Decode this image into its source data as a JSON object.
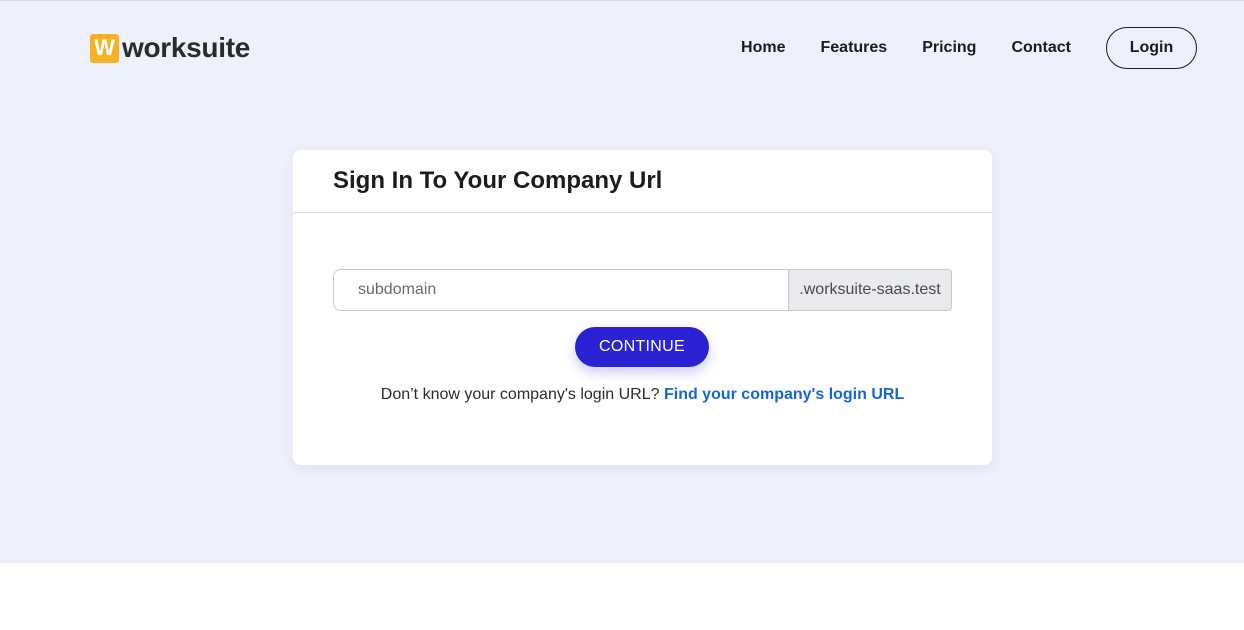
{
  "header": {
    "logo_mark": "W",
    "logo_text": "worksuite",
    "nav": [
      "Home",
      "Features",
      "Pricing",
      "Contact"
    ],
    "login_label": "Login"
  },
  "card": {
    "title": "Sign In To Your Company Url",
    "subdomain_placeholder": "subdomain",
    "subdomain_value": "",
    "domain_suffix": ".worksuite-saas.test",
    "continue_label": "CONTINUE",
    "help_text": "Don’t know your company's login URL?",
    "help_link": "Find your company's login URL"
  },
  "colors": {
    "hero_background": "#eef0fc",
    "logo_mark": "#f5b324",
    "primary_button": "#2a22d3",
    "link": "#1565d8"
  }
}
